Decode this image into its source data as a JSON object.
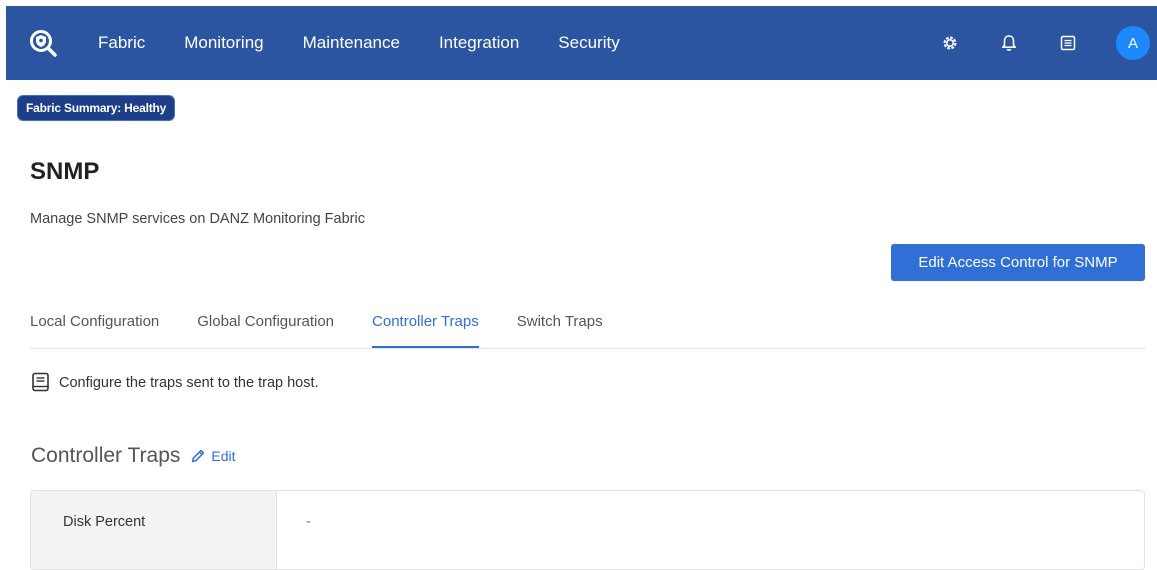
{
  "nav": {
    "items": [
      "Fabric",
      "Monitoring",
      "Maintenance",
      "Integration",
      "Security"
    ],
    "avatar_initial": "A",
    "icons": [
      "gear-icon",
      "bell-icon",
      "list-icon"
    ]
  },
  "status_badge": "Fabric Summary: Healthy",
  "page": {
    "title": "SNMP",
    "subtitle": "Manage SNMP services on DANZ Monitoring Fabric"
  },
  "actions": {
    "edit_access_control": "Edit Access Control for SNMP"
  },
  "tabs": [
    {
      "label": "Local Configuration",
      "active": false
    },
    {
      "label": "Global Configuration",
      "active": false
    },
    {
      "label": "Controller Traps",
      "active": true
    },
    {
      "label": "Switch Traps",
      "active": false
    }
  ],
  "info_text": "Configure the traps sent to the trap host.",
  "section": {
    "title": "Controller Traps",
    "edit_label": "Edit"
  },
  "table": {
    "rows": [
      {
        "label": "Disk Percent",
        "value": "-"
      }
    ]
  },
  "colors": {
    "topbar": "#2b55a0",
    "accent": "#2f6fd6",
    "badge": "#1d3f8a",
    "avatar": "#1e88ff"
  }
}
